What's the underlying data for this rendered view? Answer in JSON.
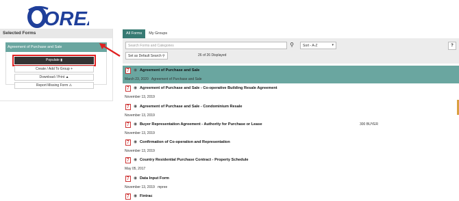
{
  "logo": {
    "text": "OREA"
  },
  "left_panel": {
    "title": "Selected Forms",
    "selected_item": {
      "label": "Agreement of Purchase and Sale",
      "remove": "×"
    },
    "buttons": {
      "populate": "Populate",
      "create_add": "Create / Add To Group",
      "download_print": "Download / Print",
      "report_missing": "Report Missing Form"
    }
  },
  "tabs": [
    {
      "label": "All Forms",
      "active": true
    },
    {
      "label": "My Groups",
      "active": false
    }
  ],
  "toolbar": {
    "search_placeholder": "Search Forms and Categories",
    "sort_value": "Sort - A-Z",
    "help": "?",
    "set_default": "Set as Default Search",
    "count": "26 of 26 Displayed"
  },
  "forms": [
    {
      "name": "Agreement of Purchase and Sale",
      "date": "March 23, 2020",
      "note": "Agreement of Purchase and Sale",
      "extra": "",
      "highlight": true
    },
    {
      "name": "Agreement of Purchase and Sale - Co-operative Building Resale Agreement",
      "date": "November 13, 2019",
      "note": "",
      "extra": ""
    },
    {
      "name": "Agreement of Purchase and Sale - Condominium Resale",
      "date": "November 13, 2019",
      "note": "",
      "extra": ""
    },
    {
      "name": "Buyer Representation Agreement - Authority for Purchase or Lease",
      "date": "November 13, 2019",
      "note": "",
      "extra": "300   BUYER"
    },
    {
      "name": "Confirmation of Co-operation and Representation",
      "date": "November 13, 2019",
      "note": "",
      "extra": ""
    },
    {
      "name": "Country Residential Purchase Contract - Property Schedule",
      "date": "May 05, 2017",
      "note": "",
      "extra": ""
    },
    {
      "name": "Data Input Form",
      "date": "November 13, 2019",
      "note": "mpree",
      "extra": ""
    },
    {
      "name": "Fintrac",
      "date": "",
      "note": "",
      "extra": ""
    }
  ],
  "colors": {
    "accent": "#377a73",
    "highlight": "#6aa6a0",
    "alert": "#e02020",
    "logo": "#1f3f9a"
  }
}
